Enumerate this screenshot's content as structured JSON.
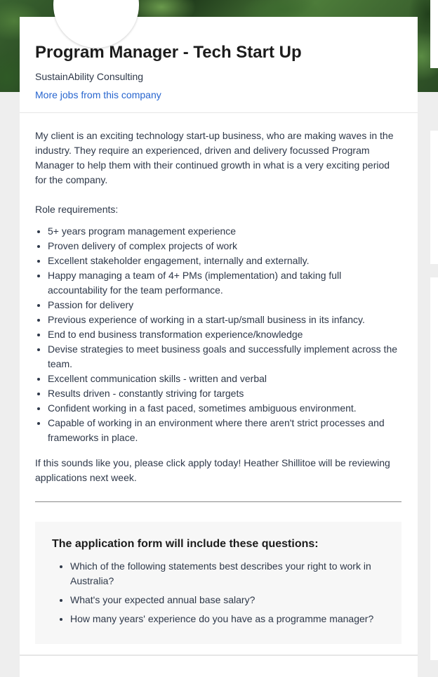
{
  "job": {
    "title": "Program Manager - Tech Start Up",
    "company": "SustainAbility Consulting",
    "more_jobs_link": "More jobs from this company"
  },
  "description": {
    "intro": "My client is an exciting technology start-up business, who are making waves in the industry. They require an experienced, driven and delivery focussed Program Manager to help them with their continued growth in what is a very exciting period for the company.",
    "requirements_heading": "Role requirements:",
    "requirements": [
      "5+ years program management experience",
      "Proven delivery of complex projects of work",
      "Excellent stakeholder engagement, internally and externally.",
      "Happy managing a team of 4+ PMs (implementation) and taking full accountability for the team performance.",
      "Passion for delivery",
      "Previous experience of working in a start-up/small business in its infancy.",
      "End to end business transformation experience/knowledge",
      "Devise strategies to meet business goals and successfully implement across the team.",
      "Excellent communication skills - written and verbal",
      "Results driven - constantly striving for targets",
      "Confident working in a fast paced, sometimes ambiguous environment.",
      "Capable of working in an environment where there aren't strict processes and frameworks in place."
    ],
    "closing": "If this sounds like you, please click apply today! Heather Shillitoe will be reviewing applications next week."
  },
  "application_questions": {
    "title": "The application form will include these questions:",
    "questions": [
      "Which of the following statements best describes your right to work in Australia?",
      "What's your expected annual base salary?",
      "How many years' experience do you have as a programme manager?"
    ]
  },
  "colors": {
    "link": "#2765cf",
    "text": "#2e3849",
    "page_background": "#eeeeee",
    "card_background": "#ffffff",
    "questions_background": "#f7f7f7"
  }
}
